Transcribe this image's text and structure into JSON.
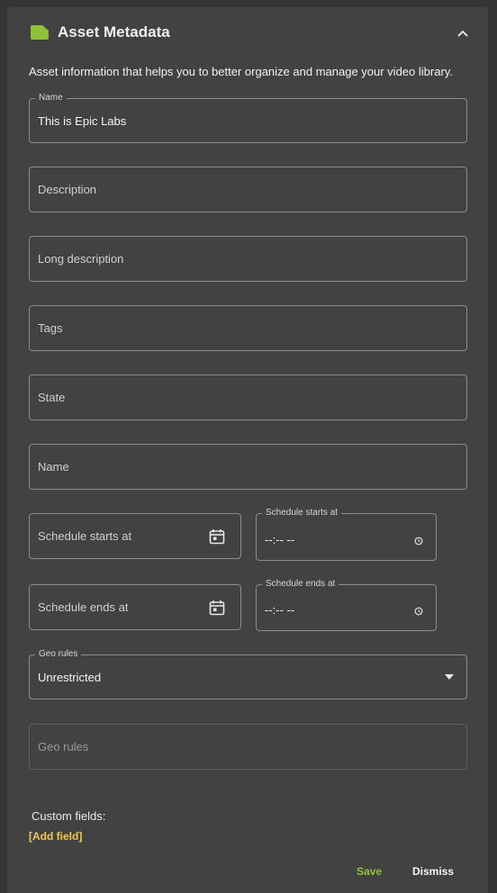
{
  "panel": {
    "title": "Asset Metadata",
    "intro": "Asset information that helps you to better organize and manage your video library.",
    "colors": {
      "accent": "#8fc23b",
      "link": "#f2c84b",
      "background": "#424242"
    }
  },
  "fields": {
    "name": {
      "legend": "Name",
      "value": "This is Epic Labs"
    },
    "description": {
      "placeholder": "Description"
    },
    "long_description": {
      "placeholder": "Long description"
    },
    "tags": {
      "placeholder": "Tags"
    },
    "state": {
      "placeholder": "State"
    },
    "name2": {
      "placeholder": "Name"
    },
    "schedule_start_date": {
      "placeholder": "Schedule starts at"
    },
    "schedule_start_time": {
      "legend": "Schedule starts at",
      "value": "--:-- --"
    },
    "schedule_end_date": {
      "placeholder": "Schedule ends at"
    },
    "schedule_end_time": {
      "legend": "Schedule ends at",
      "value": "--:-- --"
    },
    "geo_rules_select": {
      "legend": "Geo rules",
      "value": "Unrestricted"
    },
    "geo_rules_input": {
      "placeholder": "Geo rules"
    }
  },
  "custom_fields": {
    "label": "Custom fields:",
    "add_link": "[Add field]"
  },
  "actions": {
    "save": "Save",
    "dismiss": "Dismiss"
  }
}
